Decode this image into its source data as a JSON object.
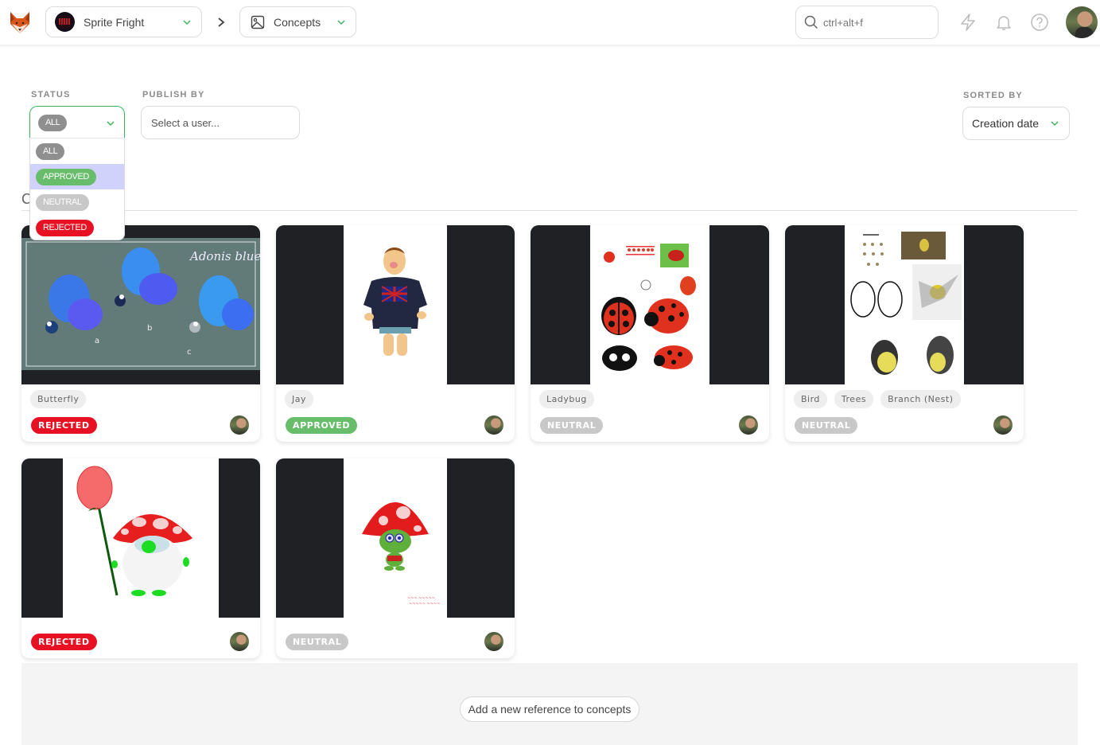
{
  "topbar": {
    "logo": "kitsu-fox-logo",
    "production": {
      "name": "Sprite Fright",
      "icon": "production-thumbnail"
    },
    "breadcrumb_separator": "chevron-right-icon",
    "section": {
      "name": "Concepts",
      "icon": "image-icon"
    },
    "search": {
      "placeholder": "ctrl+alt+f",
      "value": ""
    },
    "icons": [
      "lightning-icon",
      "bell-icon",
      "help-icon"
    ],
    "user_avatar": "user-avatar"
  },
  "filters": {
    "status": {
      "label": "STATUS",
      "selected": "ALL",
      "open": true,
      "options": [
        {
          "label": "ALL",
          "color": "#8f8f8f"
        },
        {
          "label": "APPROVED",
          "color": "#67bd6a",
          "highlighted": true
        },
        {
          "label": "NEUTRAL",
          "color": "#c8c8c8"
        },
        {
          "label": "REJECTED",
          "color": "#e81123"
        }
      ]
    },
    "publish_by": {
      "label": "PUBLISH BY",
      "placeholder": "Select a user..."
    },
    "sorted_by": {
      "label": "SORTED BY",
      "value": "Creation date"
    }
  },
  "section": {
    "heading_partial": "C"
  },
  "concepts": [
    {
      "tags": [
        "Butterfly"
      ],
      "status": "REJECTED",
      "image": "butterfly-concept-adonis-blue",
      "image_caption": "Adonis blue"
    },
    {
      "tags": [
        "Jay"
      ],
      "status": "APPROVED",
      "image": "jay-character-concept"
    },
    {
      "tags": [
        "Ladybug"
      ],
      "status": "NEUTRAL",
      "image": "ladybug-concept-sheet"
    },
    {
      "tags": [
        "Bird",
        "Trees",
        "Branch (Nest)"
      ],
      "status": "NEUTRAL",
      "image": "bird-concept-sheet"
    },
    {
      "tags": [],
      "status": "REJECTED",
      "image": "mushroom-gnome-rose-concept"
    },
    {
      "tags": [],
      "status": "NEUTRAL",
      "image": "mushroom-creature-concept"
    }
  ],
  "add_reference": {
    "label": "Add a new reference to concepts"
  },
  "colors": {
    "accent": "#3cb55c",
    "rejected": "#e81123",
    "approved": "#67bd6a",
    "neutral": "#c8c8c8",
    "all": "#8f8f8f",
    "thumbnail_bg": "#202125"
  }
}
